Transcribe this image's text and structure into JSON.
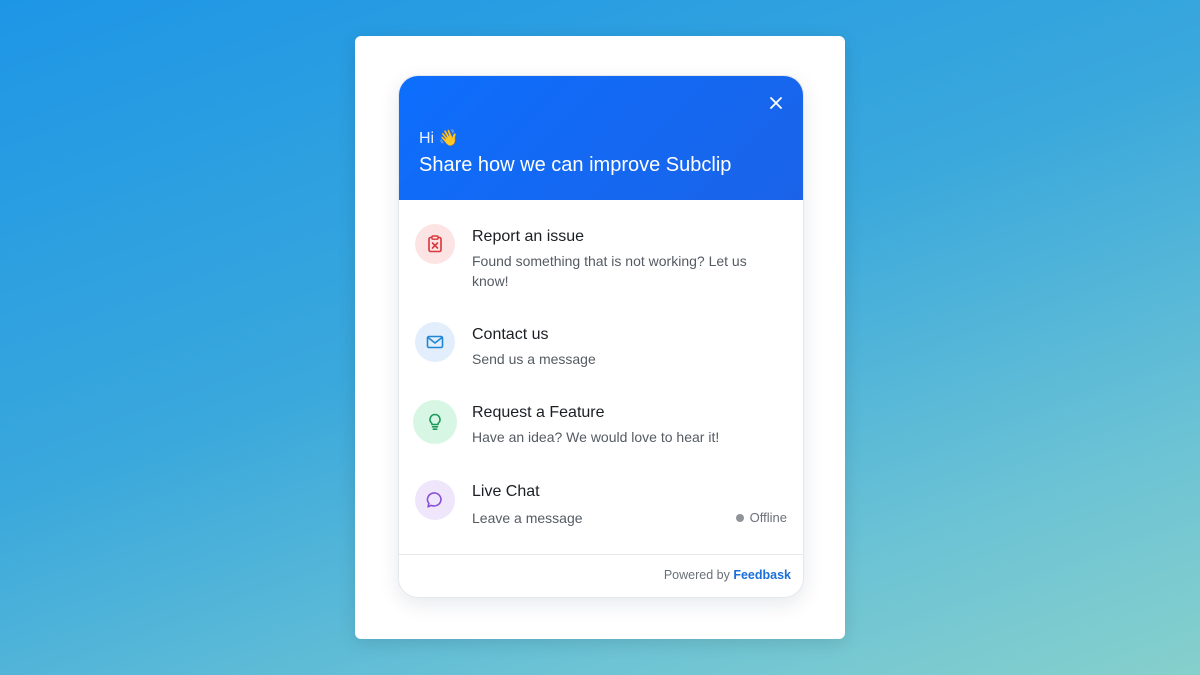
{
  "header": {
    "greeting": "Hi 👋",
    "headline": "Share how we can improve Subclip",
    "close_icon": "close-icon"
  },
  "items": [
    {
      "title": "Report an issue",
      "description": "Found something that is not working? Let us know!",
      "icon": "clipboard-x-icon",
      "color": "#d9363e",
      "bg": "#fde4e4"
    },
    {
      "title": "Contact us",
      "description": "Send us a message",
      "icon": "mail-icon",
      "color": "#1e88d4",
      "bg": "#e2eefc"
    },
    {
      "title": "Request a Feature",
      "description": "Have an idea? We would love to hear it!",
      "icon": "lightbulb-icon",
      "color": "#1c9a5a",
      "bg": "#d8f6e4"
    },
    {
      "title": "Live Chat",
      "description": "Leave a message",
      "icon": "chat-bubble-icon",
      "color": "#8a4fd8",
      "bg": "#efe6fb",
      "status": "Offline",
      "status_color": "#8f949a"
    }
  ],
  "footer": {
    "powered_by": "Powered by",
    "brand": "Feedbask"
  },
  "colors": {
    "header_bg": "#0d6efd",
    "brand_link": "#1a6fd8"
  }
}
